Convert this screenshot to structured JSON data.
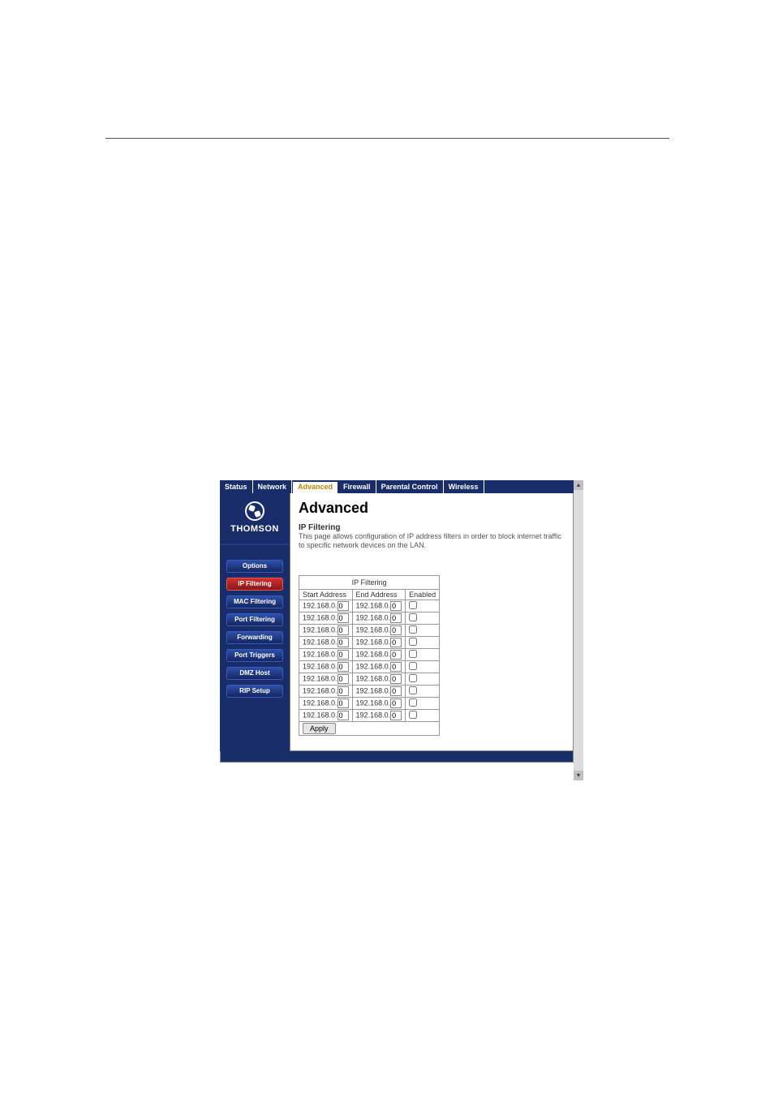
{
  "header_rule": true,
  "tabs": {
    "items": [
      "Status",
      "Network",
      "Advanced",
      "Firewall",
      "Parental Control",
      "Wireless"
    ],
    "active_index": 2
  },
  "brand": {
    "name": "THOMSON"
  },
  "sidebar": {
    "items": [
      "Options",
      "IP Filtering",
      "MAC Filtering",
      "Port Filtering",
      "Forwarding",
      "Port Triggers",
      "DMZ Host",
      "RIP Setup"
    ],
    "active_index": 1
  },
  "content": {
    "page_title": "Advanced",
    "subtitle": "IP Filtering",
    "desc": "This page allows configuration of IP address filters in order to block internet traffic to specific network devices on the LAN."
  },
  "ip_table": {
    "caption": "IP Filtering",
    "headers": [
      "Start Address",
      "End Address",
      "Enabled"
    ],
    "prefix": "192.168.0.",
    "rows": [
      {
        "start": "0",
        "end": "0",
        "enabled": false
      },
      {
        "start": "0",
        "end": "0",
        "enabled": false
      },
      {
        "start": "0",
        "end": "0",
        "enabled": false
      },
      {
        "start": "0",
        "end": "0",
        "enabled": false
      },
      {
        "start": "0",
        "end": "0",
        "enabled": false
      },
      {
        "start": "0",
        "end": "0",
        "enabled": false
      },
      {
        "start": "0",
        "end": "0",
        "enabled": false
      },
      {
        "start": "0",
        "end": "0",
        "enabled": false
      },
      {
        "start": "0",
        "end": "0",
        "enabled": false
      },
      {
        "start": "0",
        "end": "0",
        "enabled": false
      }
    ],
    "apply_label": "Apply"
  },
  "scroll": {
    "up": "▴",
    "down": "▾"
  }
}
